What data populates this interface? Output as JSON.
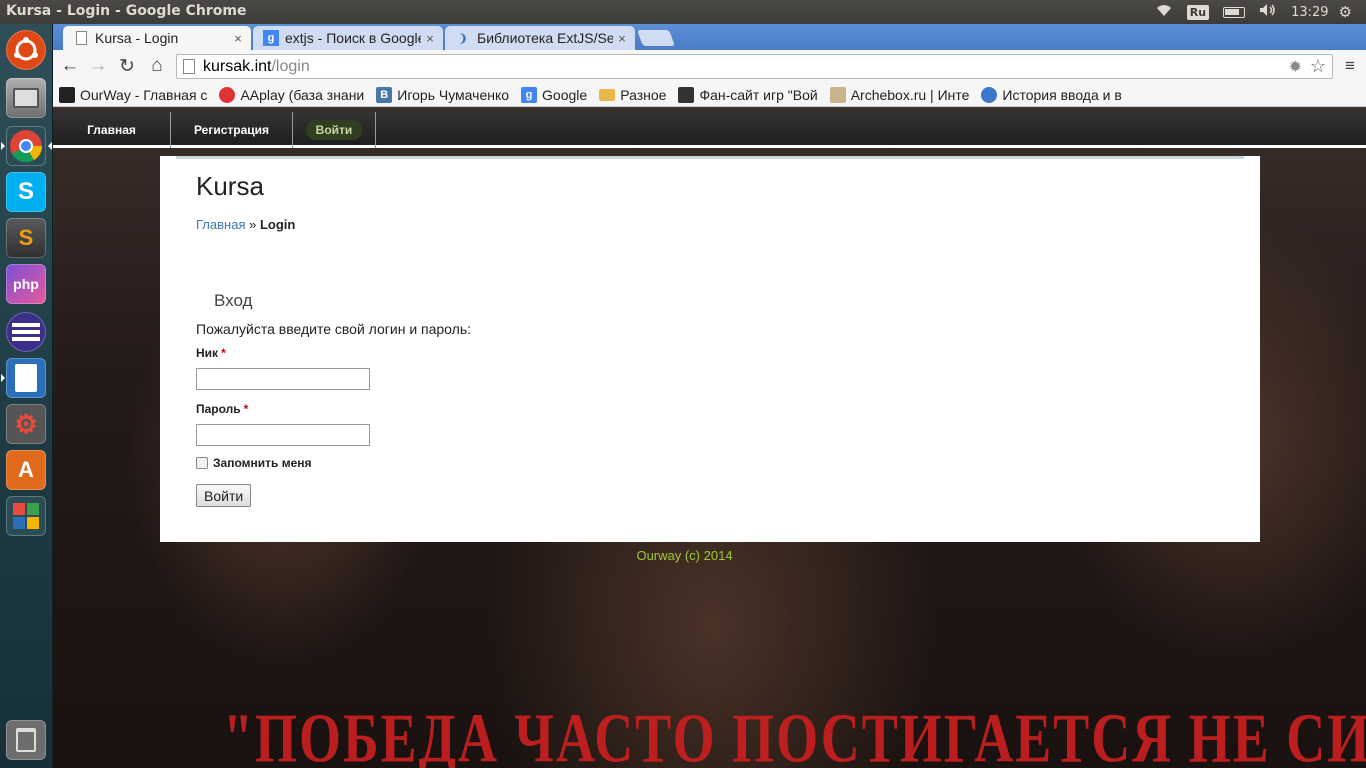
{
  "os_panel": {
    "window_title": "Kursa - Login - Google Chrome",
    "keyboard_layout": "Ru",
    "clock": "13:29",
    "icons": [
      "wifi-icon",
      "battery-icon",
      "volume-icon",
      "settings-icon"
    ]
  },
  "launcher": {
    "items": [
      {
        "name": "dash-home-icon",
        "color": "#dd4814"
      },
      {
        "name": "files-icon",
        "color": "#8a8a8a"
      },
      {
        "name": "chrome-icon",
        "color": "#e8e8e8"
      },
      {
        "name": "skype-icon",
        "color": "#00aff0",
        "glyph": "S"
      },
      {
        "name": "sublime-text-icon",
        "color": "#4a4a4a",
        "glyph": "S"
      },
      {
        "name": "phpstorm-icon",
        "color": "#7b4fd6",
        "glyph": "php"
      },
      {
        "name": "eclipse-icon",
        "color": "#3b2f8a"
      },
      {
        "name": "libreoffice-writer-icon",
        "color": "#2a6fb8"
      },
      {
        "name": "system-settings-icon",
        "color": "#555"
      },
      {
        "name": "ubuntu-software-center-icon",
        "color": "#e06a1c",
        "glyph": "A"
      },
      {
        "name": "crossover-icon",
        "color": "#3aa14a"
      },
      {
        "name": "trash-icon",
        "color": "#6d6d6d"
      }
    ]
  },
  "browser": {
    "tabs": [
      {
        "label": "Kursa - Login",
        "active": true
      },
      {
        "label": "extjs - Поиск в Google",
        "active": false
      },
      {
        "label": "Библиотека ExtJS/Sencha",
        "active": false
      }
    ],
    "tab_close": "×",
    "url_host": "kursak.int",
    "url_path": "/login",
    "bookmarks": [
      {
        "label": "OurWay - Главная с",
        "icon_color": "#222"
      },
      {
        "label": "AAplay (база знани",
        "icon_color": "#d33"
      },
      {
        "label": "Игорь Чумаченко",
        "icon_color": "#4a76a8",
        "glyph": "В"
      },
      {
        "label": "Google",
        "icon_color": "#4285f4",
        "glyph": "g"
      },
      {
        "label": "Разное",
        "icon_color": "#e8b84a"
      },
      {
        "label": "Фан-сайт игр \"Вой",
        "icon_color": "#333"
      },
      {
        "label": "Archebox.ru | Инте",
        "icon_color": "#c9b38a"
      },
      {
        "label": "История ввода и в",
        "icon_color": "#3a78c8"
      }
    ]
  },
  "site": {
    "nav": [
      {
        "label": "Главная",
        "active": false
      },
      {
        "label": "Регистрация",
        "active": false
      },
      {
        "label": "Войти",
        "active": true
      }
    ],
    "title": "Kursa",
    "breadcrumb_home": "Главная",
    "breadcrumb_sep": "»",
    "breadcrumb_current": "Login",
    "block_title": "Вход",
    "intro": "Пожалуйста введите свой логин и пароль:",
    "username_label": "Ник",
    "password_label": "Пароль",
    "required_mark": "*",
    "username_value": "",
    "password_value": "",
    "remember_label": "Запомнить меня",
    "remember_checked": false,
    "submit_label": "Войти",
    "footer": "Ourway (c) 2014",
    "poster_quote": "\"ПОБЕДА ЧАСТО ПОСТИГАЕТСЯ НЕ СИЛОЙ, А ВОЛЕЙ\" (СПАРТАК)"
  }
}
